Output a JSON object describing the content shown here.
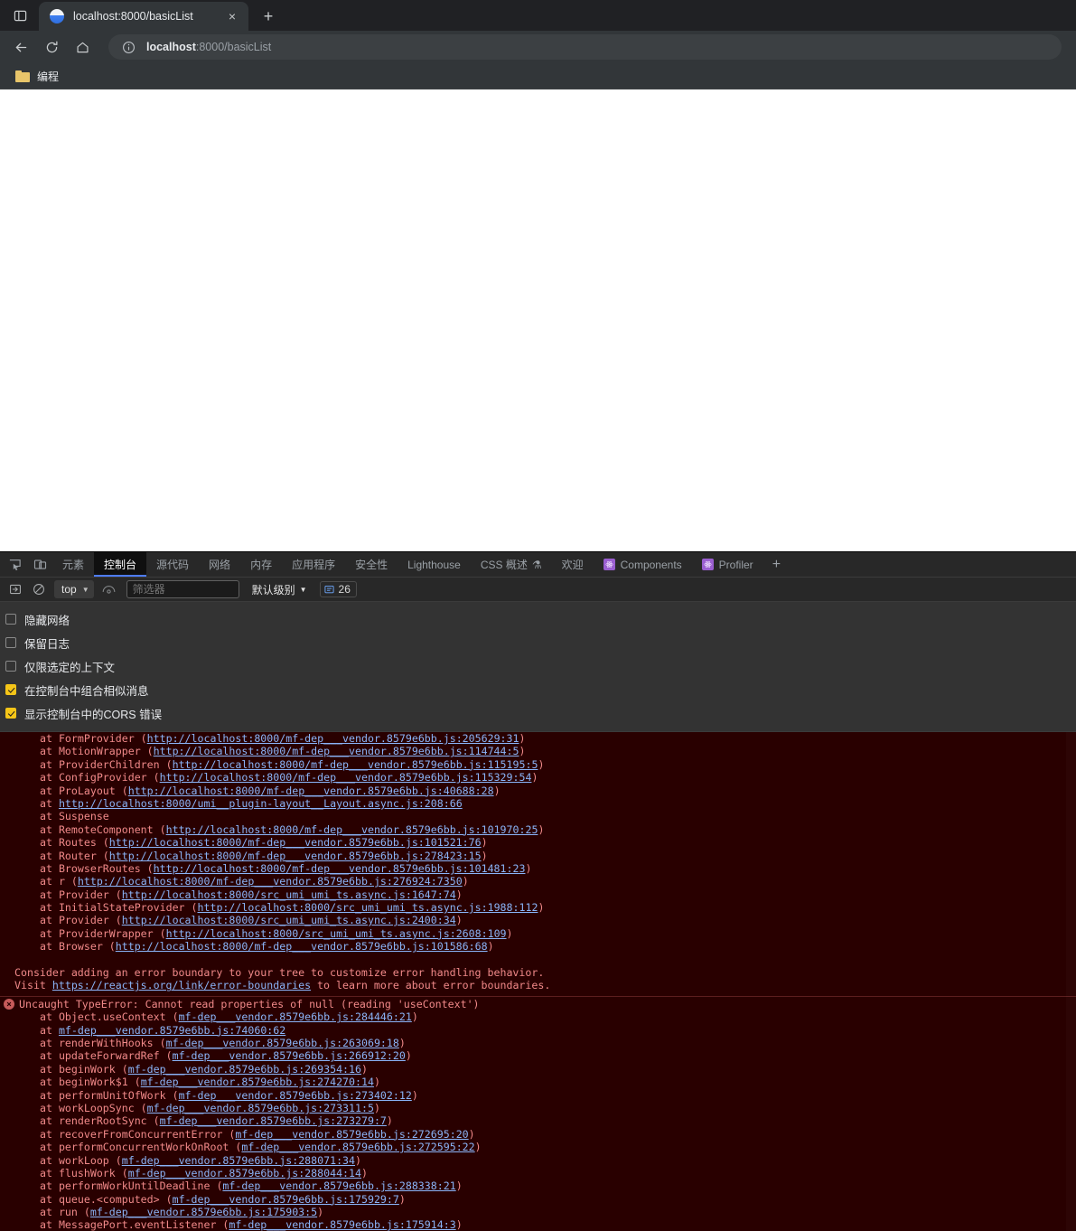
{
  "browser": {
    "sidepanel_icon": "side-panel-icon",
    "tab": {
      "title": "localhost:8000/basicList",
      "favicon": "umi-logo-icon",
      "close_icon": "×"
    },
    "new_tab_icon": "+",
    "nav": {
      "back_icon": "←",
      "reload_icon": "↻",
      "home_icon": "⌂"
    },
    "omnibox": {
      "info_icon": "info-circle-icon",
      "url_bold": "localhost",
      "url_rest": ":8000/basicList"
    },
    "bookmarks": [
      {
        "label": "编程",
        "icon": "folder-icon"
      }
    ]
  },
  "devtools": {
    "left_icons": [
      "inspect-element-icon",
      "device-toolbar-icon"
    ],
    "tabs": [
      {
        "label": "元素",
        "active": false
      },
      {
        "label": "控制台",
        "active": true
      },
      {
        "label": "源代码",
        "active": false
      },
      {
        "label": "网络",
        "active": false
      },
      {
        "label": "内存",
        "active": false
      },
      {
        "label": "应用程序",
        "active": false
      },
      {
        "label": "安全性",
        "active": false
      },
      {
        "label": "Lighthouse",
        "active": false
      },
      {
        "label": "CSS 概述",
        "active": false,
        "beaker": "⚗"
      },
      {
        "label": "欢迎",
        "active": false
      },
      {
        "label": "Components",
        "active": false,
        "ext": true
      },
      {
        "label": "Profiler",
        "active": false,
        "ext": true
      }
    ],
    "add_tab_icon": "+",
    "console_toolbar": {
      "sidebar_icon": "console-sidebar-icon",
      "clear_icon": "clear-console-icon",
      "context_value": "top",
      "eye_icon": "live-expression-icon",
      "filter_placeholder": "筛选器",
      "filter_value": "",
      "level_label": "默认级别",
      "issues_count": "26",
      "issues_icon": "issues-icon"
    },
    "settings": [
      {
        "label": "隐藏网络",
        "checked": false
      },
      {
        "label": "保留日志",
        "checked": false
      },
      {
        "label": "仅限选定的上下文",
        "checked": false
      },
      {
        "label": "在控制台中组合相似消息",
        "checked": true
      },
      {
        "label": "显示控制台中的CORS 错误",
        "checked": true
      }
    ],
    "console": {
      "stack_lines_top": [
        {
          "indent": true,
          "text": "at FormProvider (",
          "link": "http://localhost:8000/mf-dep___vendor.8579e6bb.js:205629:31",
          "tail": ")"
        },
        {
          "indent": true,
          "text": "at MotionWrapper (",
          "link": "http://localhost:8000/mf-dep___vendor.8579e6bb.js:114744:5",
          "tail": ")"
        },
        {
          "indent": true,
          "text": "at ProviderChildren (",
          "link": "http://localhost:8000/mf-dep___vendor.8579e6bb.js:115195:5",
          "tail": ")"
        },
        {
          "indent": true,
          "text": "at ConfigProvider (",
          "link": "http://localhost:8000/mf-dep___vendor.8579e6bb.js:115329:54",
          "tail": ")"
        },
        {
          "indent": true,
          "text": "at ProLayout (",
          "link": "http://localhost:8000/mf-dep___vendor.8579e6bb.js:40688:28",
          "tail": ")"
        },
        {
          "indent": true,
          "text": "at ",
          "link": "http://localhost:8000/umi__plugin-layout__Layout.async.js:208:66",
          "tail": ""
        },
        {
          "indent": true,
          "text": "at Suspense",
          "link": "",
          "tail": ""
        },
        {
          "indent": true,
          "text": "at RemoteComponent (",
          "link": "http://localhost:8000/mf-dep___vendor.8579e6bb.js:101970:25",
          "tail": ")"
        },
        {
          "indent": true,
          "text": "at Routes (",
          "link": "http://localhost:8000/mf-dep___vendor.8579e6bb.js:101521:76",
          "tail": ")"
        },
        {
          "indent": true,
          "text": "at Router (",
          "link": "http://localhost:8000/mf-dep___vendor.8579e6bb.js:278423:15",
          "tail": ")"
        },
        {
          "indent": true,
          "text": "at BrowserRoutes (",
          "link": "http://localhost:8000/mf-dep___vendor.8579e6bb.js:101481:23",
          "tail": ")"
        },
        {
          "indent": true,
          "text": "at r (",
          "link": "http://localhost:8000/mf-dep___vendor.8579e6bb.js:276924:7350",
          "tail": ")"
        },
        {
          "indent": true,
          "text": "at Provider (",
          "link": "http://localhost:8000/src_umi_umi_ts.async.js:1647:74",
          "tail": ")"
        },
        {
          "indent": true,
          "text": "at InitialStateProvider (",
          "link": "http://localhost:8000/src_umi_umi_ts.async.js:1988:112",
          "tail": ")"
        },
        {
          "indent": true,
          "text": "at Provider (",
          "link": "http://localhost:8000/src_umi_umi_ts.async.js:2400:34",
          "tail": ")"
        },
        {
          "indent": true,
          "text": "at ProviderWrapper (",
          "link": "http://localhost:8000/src_umi_umi_ts.async.js:2608:109",
          "tail": ")"
        },
        {
          "indent": true,
          "text": "at Browser (",
          "link": "http://localhost:8000/mf-dep___vendor.8579e6bb.js:101586:68",
          "tail": ")"
        }
      ],
      "advice_line_1_pre": "Consider adding an error boundary to your tree to customize error handling behavior.",
      "advice_line_2_pre": "Visit ",
      "advice_link": "https://reactjs.org/link/error-boundaries",
      "advice_line_2_post": " to learn more about error boundaries.",
      "error_title": "Uncaught TypeError: Cannot read properties of null (reading 'useContext')",
      "stack_lines_bottom": [
        {
          "indent": true,
          "text": "at Object.useContext (",
          "link": "mf-dep___vendor.8579e6bb.js:284446:21",
          "tail": ")"
        },
        {
          "indent": true,
          "text": "at ",
          "link": "mf-dep___vendor.8579e6bb.js:74060:62",
          "tail": ""
        },
        {
          "indent": true,
          "text": "at renderWithHooks (",
          "link": "mf-dep___vendor.8579e6bb.js:263069:18",
          "tail": ")"
        },
        {
          "indent": true,
          "text": "at updateForwardRef (",
          "link": "mf-dep___vendor.8579e6bb.js:266912:20",
          "tail": ")"
        },
        {
          "indent": true,
          "text": "at beginWork (",
          "link": "mf-dep___vendor.8579e6bb.js:269354:16",
          "tail": ")"
        },
        {
          "indent": true,
          "text": "at beginWork$1 (",
          "link": "mf-dep___vendor.8579e6bb.js:274270:14",
          "tail": ")"
        },
        {
          "indent": true,
          "text": "at performUnitOfWork (",
          "link": "mf-dep___vendor.8579e6bb.js:273402:12",
          "tail": ")"
        },
        {
          "indent": true,
          "text": "at workLoopSync (",
          "link": "mf-dep___vendor.8579e6bb.js:273311:5",
          "tail": ")"
        },
        {
          "indent": true,
          "text": "at renderRootSync (",
          "link": "mf-dep___vendor.8579e6bb.js:273279:7",
          "tail": ")"
        },
        {
          "indent": true,
          "text": "at recoverFromConcurrentError (",
          "link": "mf-dep___vendor.8579e6bb.js:272695:20",
          "tail": ")"
        },
        {
          "indent": true,
          "text": "at performConcurrentWorkOnRoot (",
          "link": "mf-dep___vendor.8579e6bb.js:272595:22",
          "tail": ")"
        },
        {
          "indent": true,
          "text": "at workLoop (",
          "link": "mf-dep___vendor.8579e6bb.js:288071:34",
          "tail": ")"
        },
        {
          "indent": true,
          "text": "at flushWork (",
          "link": "mf-dep___vendor.8579e6bb.js:288044:14",
          "tail": ")"
        },
        {
          "indent": true,
          "text": "at performWorkUntilDeadline (",
          "link": "mf-dep___vendor.8579e6bb.js:288338:21",
          "tail": ")"
        },
        {
          "indent": true,
          "text": "at queue.<computed> (",
          "link": "mf-dep___vendor.8579e6bb.js:175929:7",
          "tail": ")"
        },
        {
          "indent": true,
          "text": "at run (",
          "link": "mf-dep___vendor.8579e6bb.js:175903:5",
          "tail": ")"
        },
        {
          "indent": true,
          "text": "at MessagePort.eventListener (",
          "link": "mf-dep___vendor.8579e6bb.js:175914:3",
          "tail": ")"
        }
      ]
    }
  },
  "colors": {
    "accent_blue": "#4d7cfe",
    "error_bg": "#290000",
    "error_text": "#f08989",
    "link_blue": "#8ab4f8",
    "checkbox_checked": "#f5c518"
  }
}
